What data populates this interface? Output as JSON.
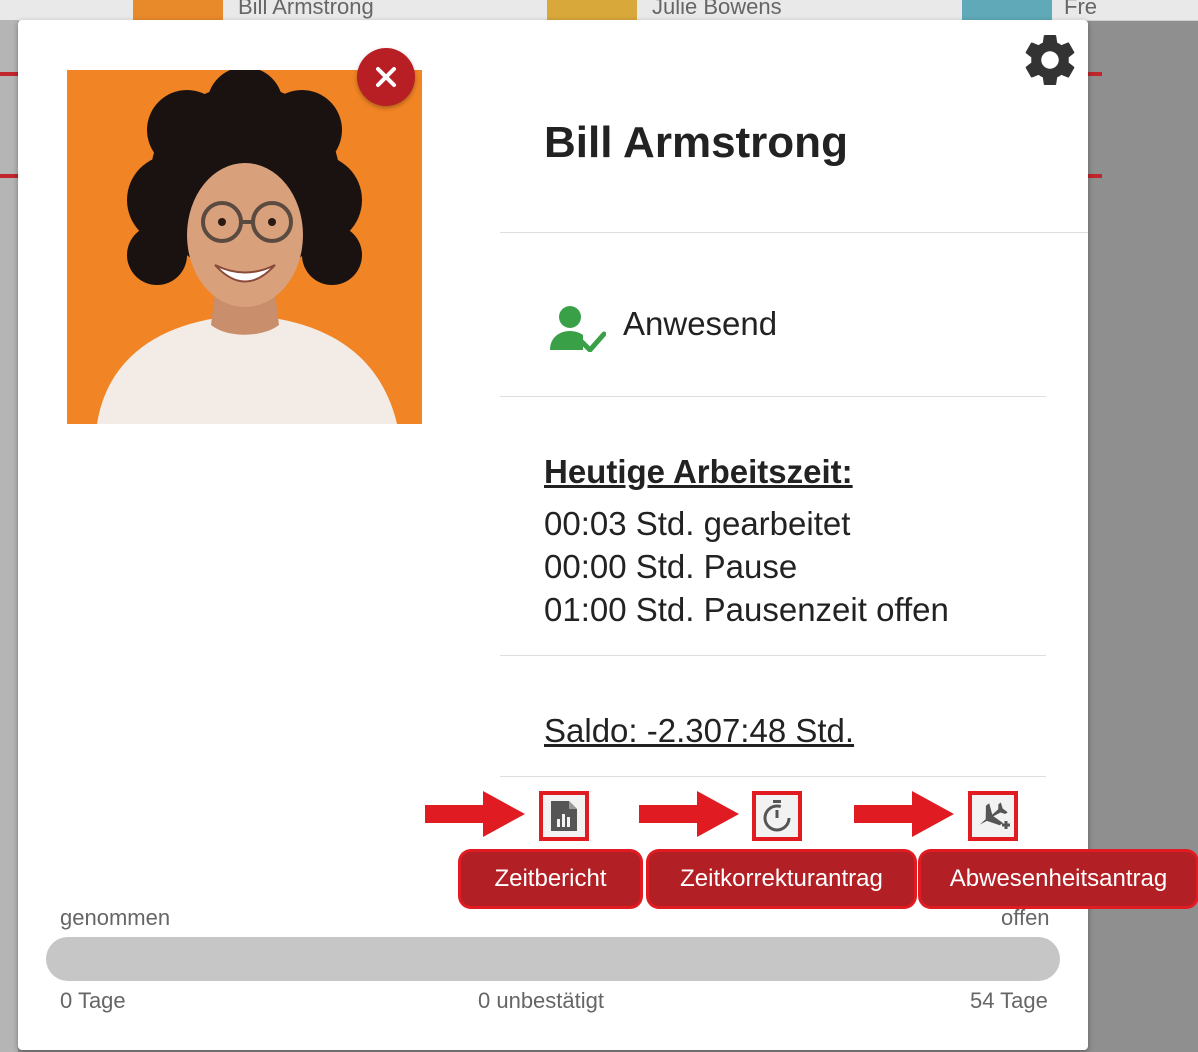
{
  "background": {
    "cards": [
      {
        "name": "Bill Armstrong",
        "thumb_color": "#e8892a"
      },
      {
        "name": "Julie Bowens",
        "thumb_color": "#d9a83a"
      },
      {
        "name": "Fre",
        "thumb_color": "#5fa9b8"
      }
    ]
  },
  "profile": {
    "name": "Bill Armstrong",
    "status": "Anwesend",
    "status_color": "#3aa048"
  },
  "worktime": {
    "title": "Heutige Arbeitszeit:",
    "lines": [
      "00:03 Std. gearbeitet",
      "00:00 Std. Pause",
      "01:00 Std. Pausenzeit offen"
    ]
  },
  "saldo": "Saldo: -2.307:48 Std.",
  "actions": [
    {
      "label": "Zeitbericht",
      "icon": "report-icon"
    },
    {
      "label": "Zeitkorrekturantrag",
      "icon": "stopwatch-icon"
    },
    {
      "label": "Abwesenheitsantrag",
      "icon": "flight-add-icon"
    }
  ],
  "vacation": {
    "label_taken": "genommen",
    "label_open": "offen",
    "taken": "0 Tage",
    "unconfirmed": "0 unbestätigt",
    "remaining": "54 Tage",
    "fraction_taken": 0
  },
  "colors": {
    "accent": "#b21f25",
    "highlight": "#e01b22",
    "photo_bg": "#f07d1c"
  }
}
